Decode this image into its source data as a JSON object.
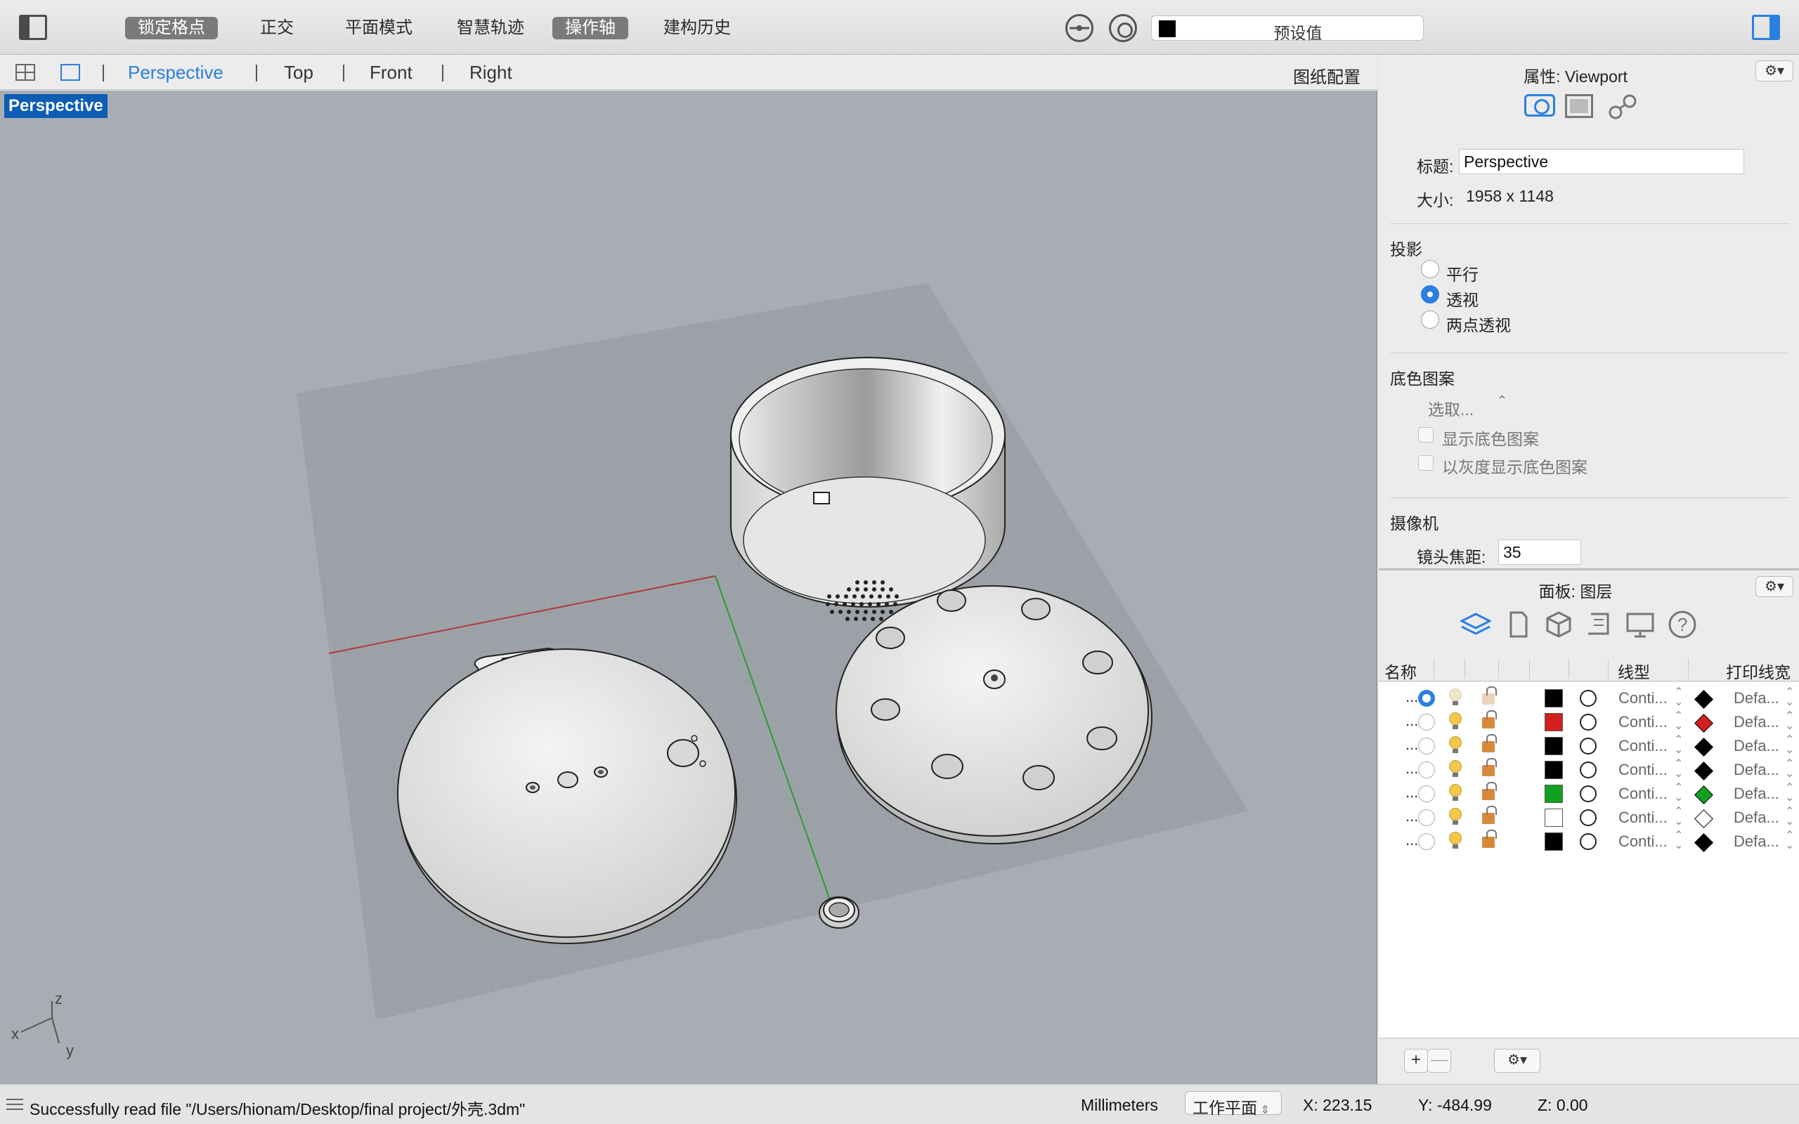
{
  "toolbar": {
    "modes": [
      {
        "label": "锁定格点",
        "active": true
      },
      {
        "label": "正交",
        "active": false
      },
      {
        "label": "平面模式",
        "active": false
      },
      {
        "label": "智慧轨迹",
        "active": false
      },
      {
        "label": "操作轴",
        "active": true
      },
      {
        "label": "建构历史",
        "active": false
      }
    ],
    "current_layer": {
      "label": "预设值",
      "color": "#000000"
    }
  },
  "viewport_tabs": {
    "tabs": [
      "Perspective",
      "Top",
      "Front",
      "Right"
    ],
    "active_tab": "Perspective",
    "layout_label": "图纸配置"
  },
  "viewport": {
    "title": "Perspective",
    "axis_labels": {
      "x": "x",
      "y": "y",
      "z": "z"
    }
  },
  "properties": {
    "title": "属性: Viewport",
    "title_label": "标题:",
    "title_value": "Perspective",
    "size_label": "大小:",
    "size_value": "1958 x 1148",
    "projection": {
      "label": "投影",
      "options": [
        "平行",
        "透视",
        "两点透视"
      ],
      "selected": "透视"
    },
    "wallpaper": {
      "label": "底色图案",
      "select_label": "选取...",
      "show_label": "显示底色图案",
      "grayscale_label": "以灰度显示底色图案"
    },
    "camera": {
      "label": "摄像机",
      "focal_label": "镜头焦距:",
      "focal_value": "35"
    }
  },
  "layers": {
    "title": "面板: 图层",
    "columns": {
      "name": "名称",
      "linetype": "线型",
      "print_width": "打印线宽"
    },
    "rows": [
      {
        "name": "...",
        "current": true,
        "color": "#000000",
        "linetype": "Conti...",
        "print_color": "#000000",
        "print_width": "Defa...",
        "visible_dim": true
      },
      {
        "name": "...",
        "current": false,
        "color": "#d21f1f",
        "linetype": "Conti...",
        "print_color": "#d21f1f",
        "print_width": "Defa...",
        "visible_dim": false
      },
      {
        "name": "...",
        "current": false,
        "color": "#000000",
        "linetype": "Conti...",
        "print_color": "#000000",
        "print_width": "Defa...",
        "visible_dim": false
      },
      {
        "name": "...",
        "current": false,
        "color": "#000000",
        "linetype": "Conti...",
        "print_color": "#000000",
        "print_width": "Defa...",
        "visible_dim": false
      },
      {
        "name": "...",
        "current": false,
        "color": "#12a11e",
        "linetype": "Conti...",
        "print_color": "#12a11e",
        "print_width": "Defa...",
        "visible_dim": false
      },
      {
        "name": "...",
        "current": false,
        "color": "#ffffff",
        "linetype": "Conti...",
        "print_color": "#ffffff",
        "print_width": "Defa...",
        "visible_dim": false
      },
      {
        "name": "...",
        "current": false,
        "color": "#000000",
        "linetype": "Conti...",
        "print_color": "#000000",
        "print_width": "Defa...",
        "visible_dim": false
      }
    ],
    "add_label": "+",
    "remove_label": "—"
  },
  "status": {
    "message": "Successfully read file \"/Users/hionam/Desktop/final project/外壳.3dm\"",
    "units": "Millimeters",
    "cplane": "工作平面",
    "x": "X: 223.15",
    "y": "Y: -484.99",
    "z": "Z: 0.00"
  }
}
